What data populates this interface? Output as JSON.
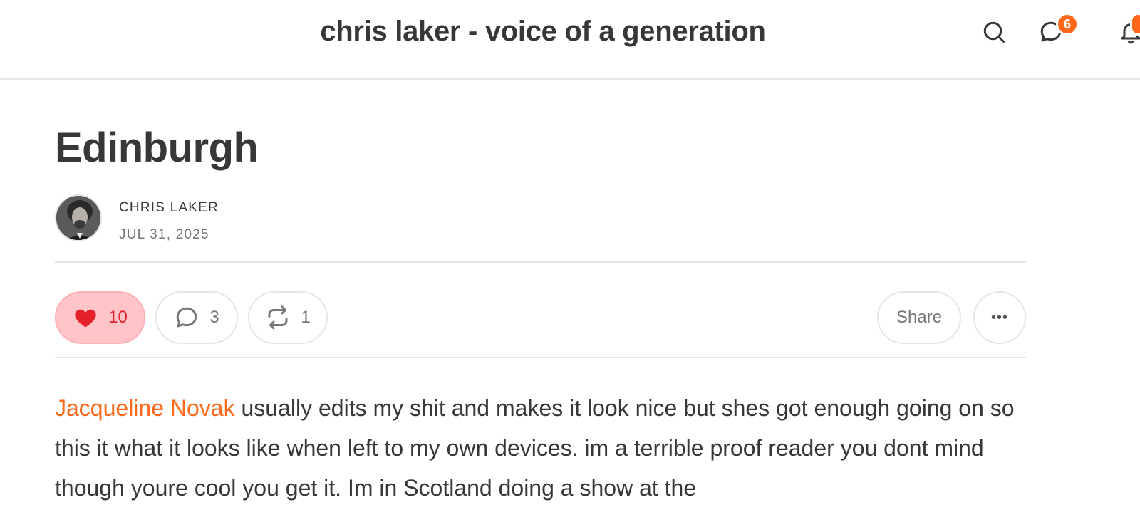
{
  "header": {
    "publication_title": "chris laker - voice of a generation",
    "icons": [
      "search-icon",
      "chat-icon",
      "bell-icon"
    ],
    "chat_badge_count": "6",
    "accent_color": "#ff6719"
  },
  "post": {
    "title": "Edinburgh",
    "author": "CHRIS LAKER",
    "date": "JUL 31, 2025",
    "actions": {
      "like_count": "10",
      "comment_count": "3",
      "restack_count": "1",
      "share_label": "Share",
      "more_label": "•••"
    },
    "body": {
      "mention": "Jacqueline Novak",
      "text": " usually edits my shit and makes it look nice but shes got enough going on so this it what it looks like when left to my own devices. im a terrible proof reader you dont mind though youre cool you get it. Im in Scotland doing a show at the"
    }
  }
}
